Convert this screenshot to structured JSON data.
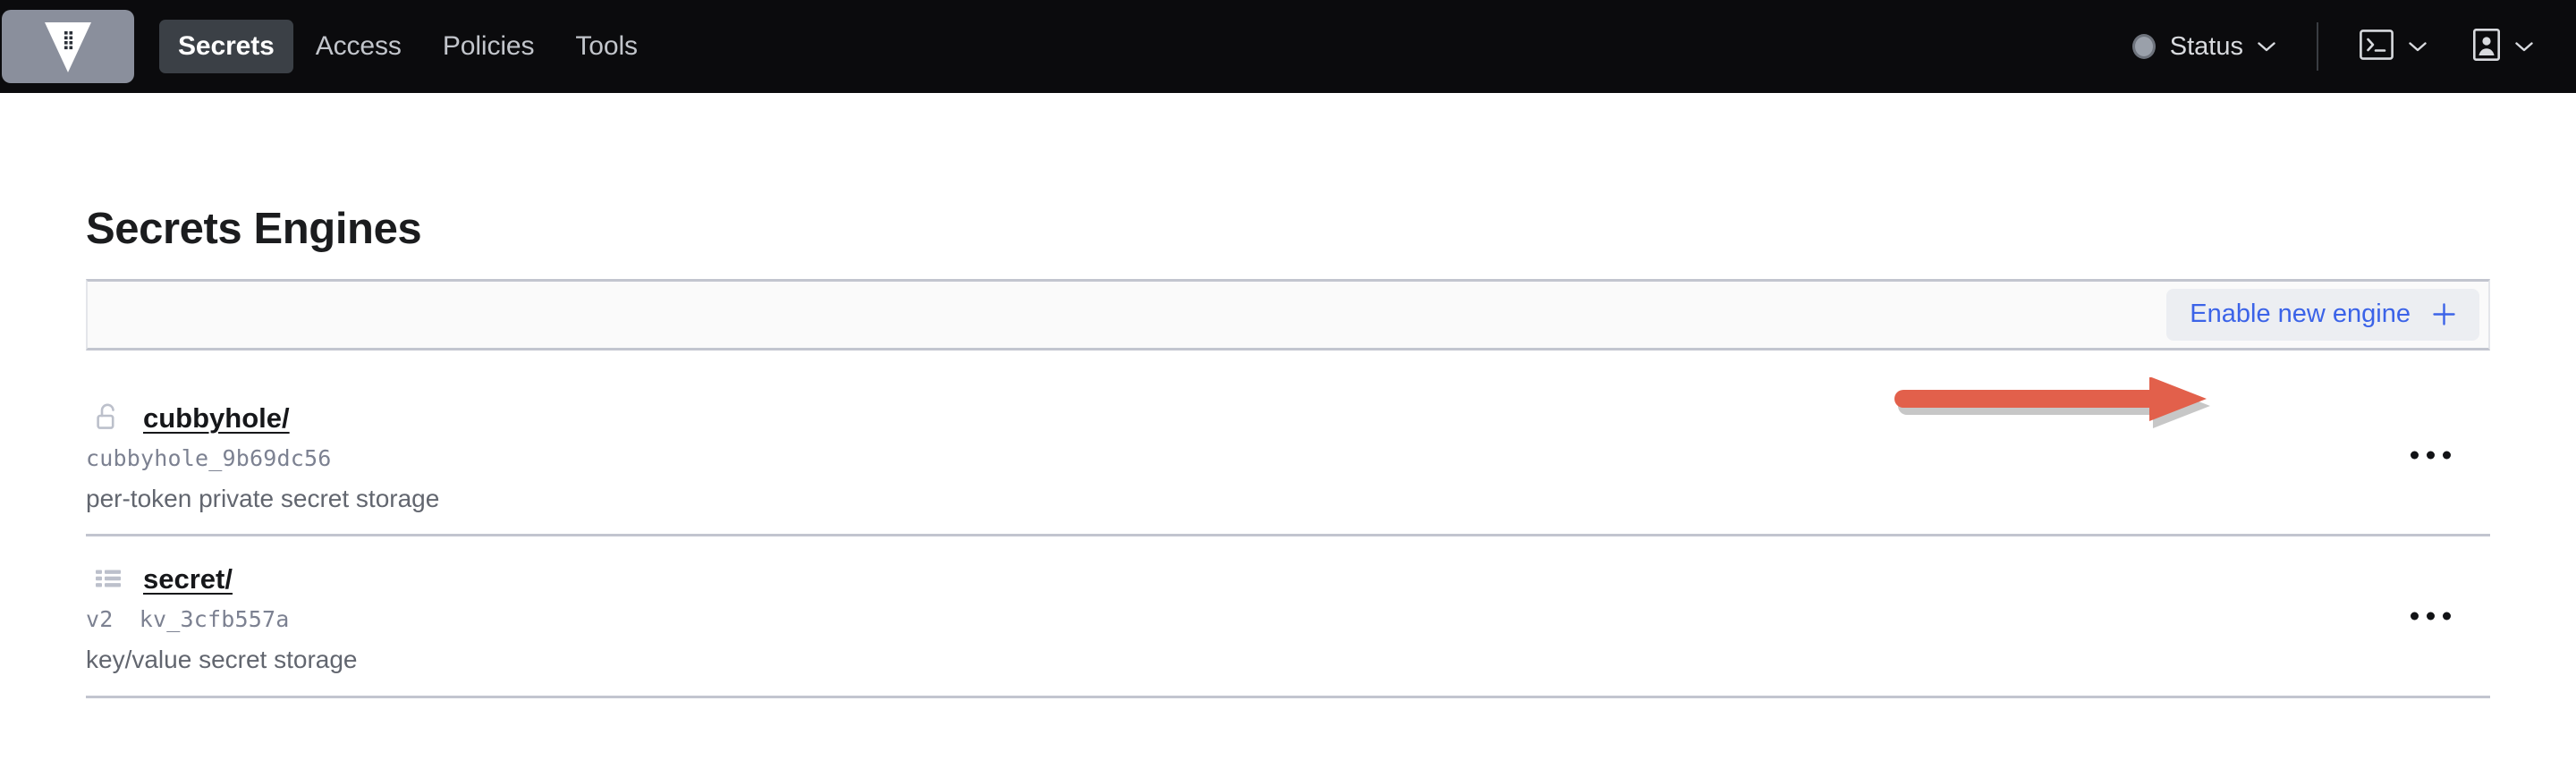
{
  "navbar": {
    "logo": {
      "name": "vault-logo",
      "alt": "Vault"
    },
    "tabs": [
      {
        "label": "Secrets",
        "active": true
      },
      {
        "label": "Access",
        "active": false
      },
      {
        "label": "Policies",
        "active": false
      },
      {
        "label": "Tools",
        "active": false
      }
    ],
    "status": {
      "label": "Status",
      "indicator_icon": "status-dot-icon",
      "chevron_icon": "chevron-down-icon"
    },
    "console": {
      "icon": "terminal-icon",
      "chevron_icon": "chevron-down-icon"
    },
    "user": {
      "icon": "user-identity-icon",
      "chevron_icon": "chevron-down-icon"
    }
  },
  "page": {
    "title": "Secrets Engines"
  },
  "toolbar": {
    "enable_engine_label": "Enable new engine",
    "enable_engine_icon": "plus-icon"
  },
  "annotation": {
    "type": "arrow",
    "direction": "right",
    "color": "#e2604b",
    "points_to": "Enable new engine"
  },
  "engines": [
    {
      "icon": "unlock-icon",
      "path": "cubbyhole/",
      "version": "",
      "accessor": "cubbyhole_9b69dc56",
      "description": "per-token private secret storage",
      "menu_icon": "more-horizontal-icon"
    },
    {
      "icon": "list-icon",
      "path": "secret/",
      "version": "v2",
      "accessor": "kv_3cfb557a",
      "description": "key/value secret storage",
      "menu_icon": "more-horizontal-icon"
    }
  ],
  "colors": {
    "navbar_bg": "#0b0b0d",
    "active_tab_bg": "#3b4046",
    "link_blue": "#3b63e8",
    "annotation_red": "#e2604b",
    "divider": "#c2c5cf",
    "toolbar_bg": "#fafafa"
  }
}
